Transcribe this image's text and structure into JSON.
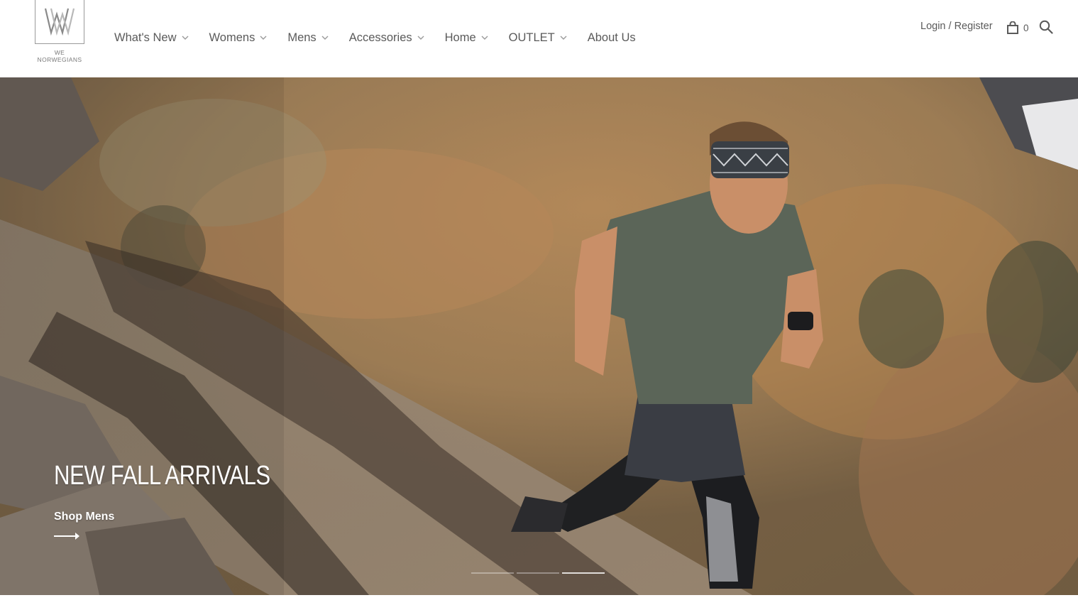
{
  "brand": {
    "logo_line1": "WE",
    "logo_line2": "NORWEGIANS",
    "logo_icon": "wn-monogram-icon"
  },
  "nav": {
    "items": [
      {
        "label": "What's New",
        "has_dropdown": true
      },
      {
        "label": "Womens",
        "has_dropdown": true
      },
      {
        "label": "Mens",
        "has_dropdown": true
      },
      {
        "label": "Accessories",
        "has_dropdown": true
      },
      {
        "label": "Home",
        "has_dropdown": true
      },
      {
        "label": "OUTLET",
        "has_dropdown": true
      },
      {
        "label": "About Us",
        "has_dropdown": false
      }
    ]
  },
  "header_utility": {
    "login_label": "Login / Register",
    "cart_icon": "shopping-bag-icon",
    "cart_count": "0",
    "search_icon": "search-icon"
  },
  "hero": {
    "title": "NEW FALL ARRIVALS",
    "cta_label": "Shop Mens",
    "cta_icon": "arrow-right-icon",
    "slides_total": 3,
    "active_slide": 3
  },
  "colors": {
    "text": "#5a5a5a",
    "chevron": "#9a9a9a",
    "hero_text": "#ffffff",
    "background": "#ffffff"
  }
}
